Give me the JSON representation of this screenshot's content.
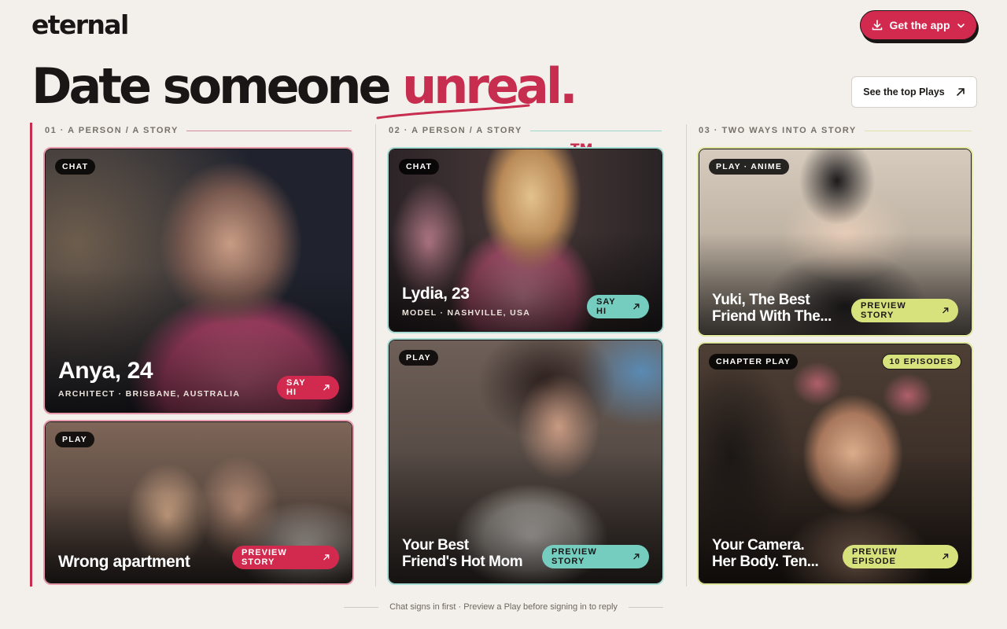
{
  "header": {
    "logo": "eternal",
    "get_app_label": "Get the app",
    "top_plays_label": "See the top Plays"
  },
  "hero": {
    "lead": "Date someone ",
    "highlight": "unreal.",
    "trademark": "TM"
  },
  "columns": [
    {
      "heading": "01 · A PERSON / A STORY"
    },
    {
      "heading": "02 · A PERSON / A STORY"
    },
    {
      "heading": "03 · TWO WAYS INTO A STORY"
    }
  ],
  "cards": {
    "anya": {
      "tag": "CHAT",
      "name": "Anya, 24",
      "meta": "ARCHITECT · BRISBANE, AUSTRALIA",
      "button": "SAY HI"
    },
    "wrong_apartment": {
      "tag": "PLAY",
      "title": "Wrong apartment",
      "button": "PREVIEW STORY"
    },
    "lydia": {
      "tag": "CHAT",
      "name": "Lydia, 23",
      "meta": "MODEL · NASHVILLE, USA",
      "button": "SAY HI"
    },
    "hot_mom": {
      "tag": "PLAY",
      "title_line1": "Your Best",
      "title_line2": "Friend's Hot Mom",
      "button": "PREVIEW STORY"
    },
    "yuki": {
      "tag": "PLAY · ANIME",
      "title_line1": "Yuki, The Best",
      "title_line2": "Friend With The...",
      "button": "PREVIEW STORY"
    },
    "camera": {
      "tag": "CHAPTER PLAY",
      "badge": "10 EPISODES",
      "title_line1": "Your Camera.",
      "title_line2": "Her Body. Ten...",
      "button": "PREVIEW EPISODE"
    }
  },
  "footer": {
    "note": "Chat signs in first · Preview a Play before signing in to reply"
  },
  "colors": {
    "brand_red": "#d22a4e",
    "teal": "#74cdbf",
    "lime": "#d8e27d",
    "background": "#f3efea"
  },
  "icons": [
    "download-icon",
    "chevron-down-icon",
    "arrow-up-right-icon"
  ]
}
